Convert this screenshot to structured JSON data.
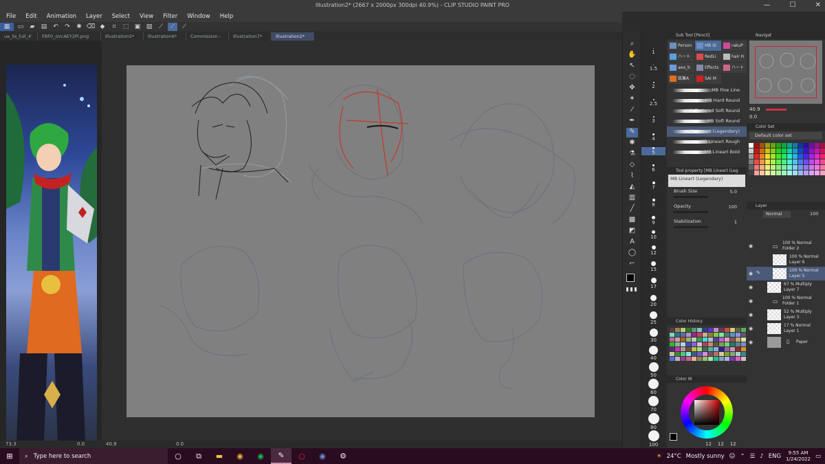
{
  "window": {
    "title": "Illustration2* (2667 x 2000px 300dpi 40.9%) - CLIP STUDIO PAINT PRO",
    "controls": [
      "—",
      "☐",
      "✕"
    ]
  },
  "menu": [
    "File",
    "Edit",
    "Animation",
    "Layer",
    "Select",
    "View",
    "Filter",
    "Window",
    "Help"
  ],
  "tabs": [
    {
      "label": "ue_lis_full_4ʼ",
      "active": false
    },
    {
      "label": "FBF0_oVcAEY2Pl.png",
      "active": false
    },
    {
      "label": "Illustration5*",
      "active": false
    },
    {
      "label": "Illustration6*",
      "active": false
    },
    {
      "label": "Commission - ",
      "active": false
    },
    {
      "label": "Illustration7*",
      "active": false
    },
    {
      "label": "Illustration2*",
      "active": true
    }
  ],
  "statusbar": {
    "left_zoom": "73.3",
    "left_angle": "0.0",
    "canvas_zoom": "40.9",
    "canvas_angle": "0.0"
  },
  "brush_sizes": [
    "1",
    "1.5",
    "2",
    "2.5",
    "3",
    "4",
    "5",
    "6",
    "7",
    "8",
    "9",
    "10",
    "12",
    "15",
    "17",
    "20",
    "25",
    "30",
    "40",
    "50",
    "60",
    "70",
    "80",
    "100"
  ],
  "subtool": {
    "header": "Sub Tool [Pencil]",
    "tabs": [
      {
        "label": "Person",
        "active": false
      },
      {
        "label": "MB SI",
        "active": true
      },
      {
        "label": "rakuP",
        "active": false
      },
      {
        "label": "ハート",
        "active": false
      },
      {
        "label": "RedLi",
        "active": false
      },
      {
        "label": "hair H",
        "active": false
      },
      {
        "label": "aea_b",
        "active": false
      },
      {
        "label": "Effects",
        "active": false
      },
      {
        "label": "ハート",
        "active": false
      },
      {
        "label": "鉛筆A",
        "active": false
      },
      {
        "label": "SAI M",
        "active": false
      }
    ],
    "brushes": [
      {
        "label": "MB Fine Line",
        "active": false
      },
      {
        "label": "MB Hard Round",
        "active": false
      },
      {
        "label": "MB Textured Soft Round",
        "active": false
      },
      {
        "label": "MB Soft Round",
        "active": false
      },
      {
        "label": "MB Lineart (Legendary)",
        "active": true
      },
      {
        "label": "MB Lineart Rough",
        "active": false
      },
      {
        "label": "MB Lineart Bold",
        "active": false
      }
    ]
  },
  "toolprop": {
    "header": "Tool property [MB Lineart (Leg",
    "preset": "MB Lineart (Legendary)",
    "brush_size_label": "Brush Size",
    "brush_size": "5.0",
    "opacity_label": "Opacity",
    "opacity": "100",
    "stabilization_label": "Stabilization",
    "stabilization": "1"
  },
  "history": {
    "header": "Color History"
  },
  "colorwheel": {
    "header": "Color W",
    "v1": "12",
    "v2": "12",
    "v3": "12"
  },
  "navigator": {
    "header": "Navigat",
    "zoom": "40.9",
    "angle": "0.0"
  },
  "colorset": {
    "header": "Color Set",
    "selected": "Default color set"
  },
  "layers": {
    "header": "Layer",
    "blend_mode": "Normal",
    "opacity": "100",
    "rows": [
      {
        "line1": "100 % Normal",
        "line2": "Folder 2",
        "type": "folder",
        "active": false
      },
      {
        "line1": "100 % Normal",
        "line2": "Layer 6",
        "type": "layer",
        "active": false
      },
      {
        "line1": "100 % Normal",
        "line2": "Layer 5",
        "type": "layer",
        "active": true
      },
      {
        "line1": "67 % Multiply",
        "line2": "Layer 7",
        "type": "layer",
        "active": false
      },
      {
        "line1": "100 % Normal",
        "line2": "Folder 1",
        "type": "folder",
        "active": false
      },
      {
        "line1": "52 % Multiply",
        "line2": "Layer 3",
        "type": "layer",
        "active": false
      },
      {
        "line1": "17 % Normal",
        "line2": "Layer 1",
        "type": "layer",
        "active": false
      },
      {
        "line1": "",
        "line2": "Paper",
        "type": "paper",
        "active": false
      }
    ]
  },
  "taskbar": {
    "search_placeholder": "Type here to search",
    "weather_temp": "24°C",
    "weather_text": "Mostly sunny",
    "lang": "ENG",
    "time": "9:55 AM",
    "date": "1/24/2022"
  }
}
